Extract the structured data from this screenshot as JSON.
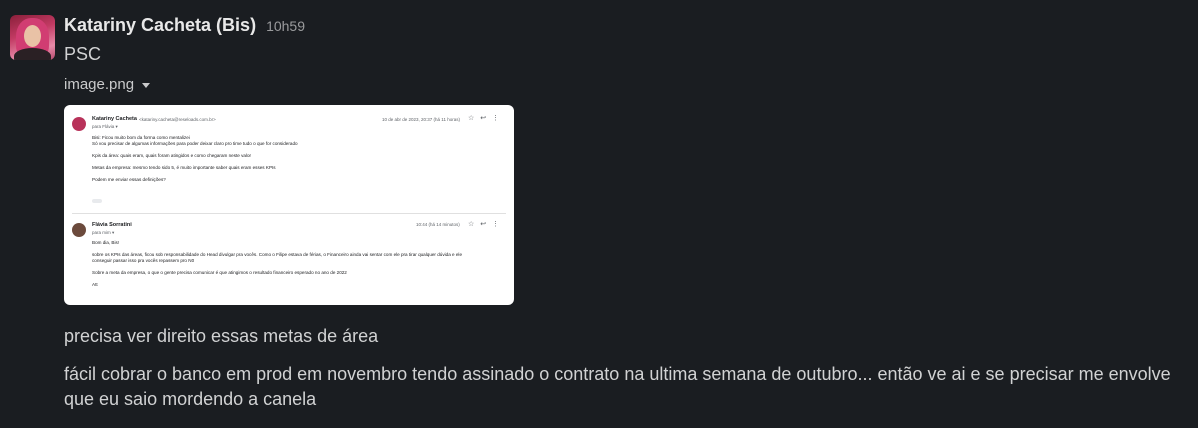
{
  "message": {
    "sender": "Katariny Cacheta (Bis)",
    "time": "10h59",
    "text": "PSC",
    "attachment_name": "image.png"
  },
  "email_preview": {
    "email1": {
      "sender": "Katariny Cacheta",
      "address": "<katariny.cacheta@reseloads.com.br>",
      "to": "para Flávia ▾",
      "date": "10 de abr de 2023, 20:37 (há 11 horas)",
      "lines": [
        "Bisi: Ficou muito bom da forma como mentalizei",
        "Só vou precisar de algumas informações para poder deixar claro pro time tudo o que for considerado",
        "",
        "Kpis da área: quais eram, quais foram atingidos e como chegaram neste valor",
        "",
        "Metas da empresa: mesmo tendo sido 5, é muito importante saber quais eram esses KPIs",
        "",
        "Podem me enviar essas definições?"
      ]
    },
    "email2": {
      "sender": "Flávia Sorratini",
      "to": "para mim ▾",
      "date": "10:44 (há 14 minutos)",
      "lines": [
        "Bom dia, Bis!",
        "",
        "sobre os KPIs das áreas, ficou sob responsabilidade do Head divulgar pra vocês. Como o Filipe estava de férias, o Financeiro ainda vai sentar com ele pra tirar qualquer dúvida e ele",
        "conseguir passar isso pra vocês repassem pro N0",
        "",
        "Sobre a meta da empresa, o que o gente precisa comunicar é que atingimos o resultado financeiro esperado no ano de 2022",
        "",
        "Att"
      ]
    },
    "icons": [
      "star-icon",
      "reply-icon",
      "more-icon"
    ]
  },
  "followups": [
    "precisa ver direito essas metas de área",
    "fácil cobrar o banco em prod em novembro tendo assinado o contrato na ultima semana de outubro... então ve ai e se precisar me envolve que eu saio mordendo a canela"
  ]
}
